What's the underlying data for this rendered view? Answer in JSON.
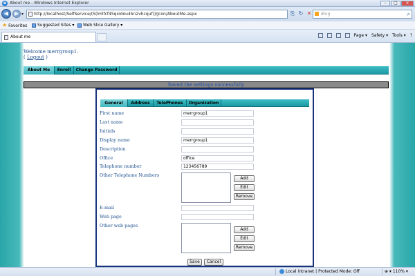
{
  "window": {
    "title": "About me - Windows Internet Explorer",
    "icon": "ie-icon"
  },
  "address": {
    "url": "http://localhost/SelfService/(S(lmlfcf45qxidou45n2vhcquf))/Jcon/AboutMe.aspx",
    "search_placeholder": "Bing"
  },
  "favorites": {
    "label": "Favorites",
    "suggested": "Suggested Sites ▾",
    "slice": "Web Slice Gallery ▾"
  },
  "tab": {
    "title": "About me"
  },
  "commands": [
    "Page ▾",
    "Safety ▾",
    "Tools ▾"
  ],
  "page": {
    "welcome": "Welcome  merrgroup1.",
    "logout_open": "(",
    "logout_label": "Logout",
    "logout_close": ")",
    "nav": [
      {
        "label": "About Me",
        "active": true
      },
      {
        "label": "Enroll",
        "active": false
      },
      {
        "label": "Change Password",
        "active": false
      }
    ],
    "status_message": "Saved the settings successfully",
    "subtabs": [
      {
        "label": "General",
        "active": true
      },
      {
        "label": "Address",
        "active": false
      },
      {
        "label": "TelePhones",
        "active": false
      },
      {
        "label": "Organization",
        "active": false
      }
    ],
    "fields": {
      "first_name": {
        "label": "First name",
        "value": "merrgroup1"
      },
      "last_name": {
        "label": "Last name",
        "value": ""
      },
      "initials": {
        "label": "Initials",
        "value": ""
      },
      "display_name": {
        "label": "Display name",
        "value": "merrgroup1"
      },
      "description": {
        "label": "Description",
        "value": ""
      },
      "office": {
        "label": "Office",
        "value": "office"
      },
      "telephone": {
        "label": "Telephone number",
        "value": "123456789"
      },
      "other_telephones": {
        "label": "Other Telephone Numbers"
      },
      "email": {
        "label": "E-mail",
        "value": ""
      },
      "web_page": {
        "label": "Web page",
        "value": ""
      },
      "other_web_pages": {
        "label": "Other web pages"
      }
    },
    "list_buttons": {
      "add": "Add",
      "edit": "Edit",
      "remove": "Remove"
    },
    "footer": {
      "save": "Save",
      "cancel": "Cancel"
    }
  },
  "statusbar": {
    "zone": "Local intranet | Protected Mode: Off",
    "zoom": "⊕ ▾ 110% ▾"
  }
}
